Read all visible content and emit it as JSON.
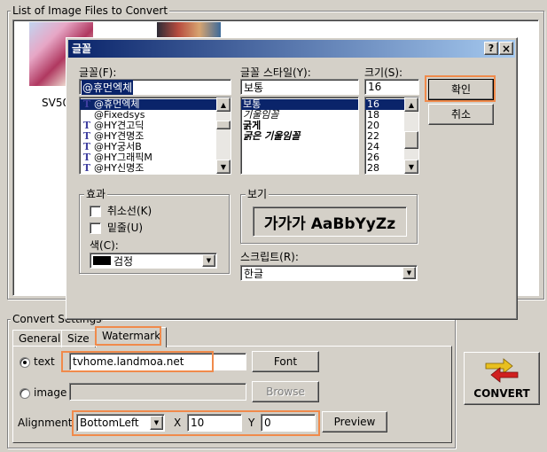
{
  "app": {
    "image_list_title": "List of Image Files to Convert",
    "thumbnail_label": "SV50",
    "convert_settings_title": "Convert Settings",
    "tabs": [
      "General",
      "Size",
      "Watermark"
    ],
    "active_tab": "Watermark",
    "text_option_label": "text",
    "text_value": "tvhome.landmoa.net",
    "font_button": "Font",
    "image_option_label": "image",
    "image_value": "",
    "browse_button": "Browse",
    "alignment_label": "Alignment",
    "alignment_value": "BottomLeft",
    "x_label": "X",
    "x_value": "10",
    "y_label": "Y",
    "y_value": "0",
    "preview_button": "Preview",
    "convert_button": "CONVERT"
  },
  "dialog": {
    "title": "글꼴",
    "help_button": "?",
    "close_button": "×",
    "font_label": "글꼴(F):",
    "font_value": "@휴먼엑체",
    "font_list": [
      "@휴먼엑체",
      "@Fixedsys",
      "@HY견고딕",
      "@HY견명조",
      "@HY궁서B",
      "@HY그래픽M",
      "@HY신명조"
    ],
    "style_label": "글꼴 스타일(Y):",
    "style_value": "보통",
    "style_list": [
      "보통",
      "기울임꼴",
      "굵게",
      "굵은 기울임꼴"
    ],
    "size_label": "크기(S):",
    "size_value": "16",
    "size_list": [
      "16",
      "18",
      "20",
      "22",
      "24",
      "26",
      "28"
    ],
    "ok_button": "확인",
    "cancel_button": "취소",
    "effects_title": "효과",
    "strikeout_label": "취소선(K)",
    "underline_label": "밑줄(U)",
    "color_label": "색(C):",
    "color_value": "검정",
    "preview_title": "보기",
    "preview_sample": "가가가 AaBbYyZz",
    "script_label": "스크립트(R):",
    "script_value": "한글"
  },
  "colors": {
    "highlight": "#f08a4b",
    "title_bar_start": "#0a246a",
    "title_bar_end": "#a6caf0",
    "selection": "#0a246a",
    "face": "#d4d0c8"
  }
}
